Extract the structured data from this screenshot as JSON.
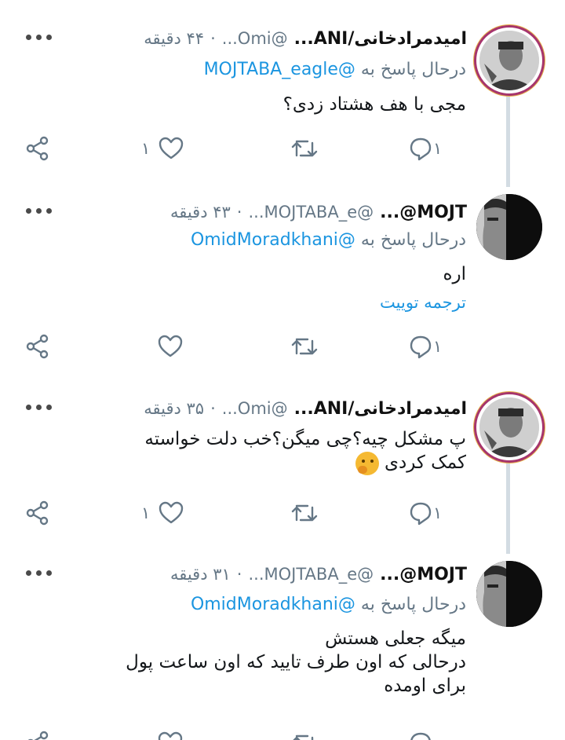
{
  "tweets": [
    {
      "name": "امیدمرادخانی/ANI...",
      "handle": "@Omi...",
      "time": "۴۴ دقیقه",
      "reply_prefix": "درحال پاسخ به",
      "reply_to": "@MOJTABA_eagle",
      "text_lines": [
        "مجی با هف هشتاد زدی؟"
      ],
      "translate": "",
      "reply_count": "۱",
      "retweet_count": "",
      "like_count": "۱"
    },
    {
      "name": "MOJT@...",
      "handle": "@MOJTABA_e...",
      "time": "۴۳ دقیقه",
      "reply_prefix": "درحال پاسخ به",
      "reply_to": "@OmidMoradkhani",
      "text_lines": [
        "اره"
      ],
      "translate": "ترجمه توییت",
      "reply_count": "۱",
      "retweet_count": "",
      "like_count": ""
    },
    {
      "name": "امیدمرادخانی/ANI...",
      "handle": "@Omi...",
      "time": "۳۵ دقیقه",
      "reply_prefix": "",
      "reply_to": "",
      "text_lines": [
        "پ مشکل چیه؟چی میگن؟خب دلت خواسته",
        "کمک کردی"
      ],
      "translate": "",
      "reply_count": "۱",
      "retweet_count": "",
      "like_count": "۱"
    },
    {
      "name": "MOJT@...",
      "handle": "@MOJTABA_e...",
      "time": "۳۱ دقیقه",
      "reply_prefix": "درحال پاسخ به",
      "reply_to": "@OmidMoradkhani",
      "text_lines": [
        "میگه جعلی هستش",
        "درحالی که اون طرف تایید که اون ساعت پول",
        "برای اومده"
      ],
      "translate": "",
      "reply_count": "",
      "retweet_count": "",
      "like_count": ""
    }
  ],
  "separator": "·",
  "colors": {
    "accent": "#1b95e0",
    "secondary_text": "#657786",
    "thread_line": "#d3dce3"
  }
}
